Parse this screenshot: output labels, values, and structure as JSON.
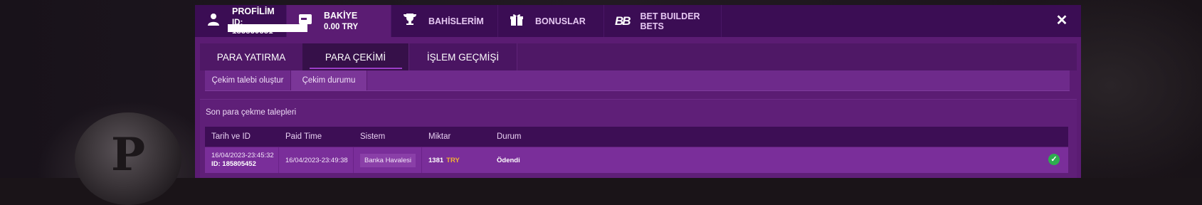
{
  "top_tabs": [
    {
      "title": "PROFİLİM",
      "sub": "ID: 183839551",
      "icon": "user-icon"
    },
    {
      "title": "BAKİYE",
      "sub": "0.00 TRY",
      "icon": "wallet-icon"
    },
    {
      "title": "BAHİSLERİM",
      "icon": "trophy-icon"
    },
    {
      "title": "BONUSLAR",
      "icon": "gift-icon"
    },
    {
      "title": "BET BUILDER BETS",
      "icon": "bb-logo-icon"
    }
  ],
  "close_glyph": "✕",
  "sub_tabs": [
    {
      "label": "PARA YATIRMA"
    },
    {
      "label": "PARA ÇEKİMİ"
    },
    {
      "label": "İŞLEM GEÇMİŞİ"
    }
  ],
  "inner_tabs": [
    {
      "label": "Çekim talebi oluştur"
    },
    {
      "label": "Çekim durumu"
    }
  ],
  "section_title": "Son para çekme talepleri",
  "table": {
    "headers": [
      "Tarih ve ID",
      "Paid Time",
      "Sistem",
      "Miktar",
      "Durum"
    ],
    "rows": [
      {
        "date": "16/04/2023-23:45:32",
        "id": "ID: 185805452",
        "paid_time": "16/04/2023-23:49:38",
        "system": "Banka Havalesi",
        "amount": "1381",
        "currency": "TRY",
        "status": "Ödendi"
      }
    ]
  },
  "colors": {
    "modal_bg": "#5b1c73",
    "tabbar_bg": "#3b0d54",
    "accent_underline": "#9b3dc6",
    "currency": "#f2b234",
    "success": "#2eac4f"
  }
}
